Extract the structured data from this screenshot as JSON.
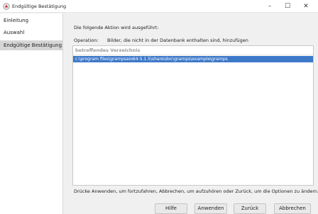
{
  "window": {
    "title": "Endgültige Bestätigung",
    "app_icon": "gramps-app-icon",
    "controls": {
      "minimize": "–",
      "maximize": "☐",
      "close": "✕"
    }
  },
  "sidebar": {
    "items": [
      {
        "label": "Einleitung",
        "active": false
      },
      {
        "label": "Auswahl",
        "active": false
      },
      {
        "label": "Endgültige Bestätigung",
        "active": true
      }
    ]
  },
  "main": {
    "description": "Die folgende Aktion wird ausgeführt:",
    "operation_label": "Operation:",
    "operation_value": "Bilder, die nicht in der Datenbank enthalten sind, hinzufügen",
    "list": {
      "header": "betreffendes Verzeichnis",
      "rows": [
        "c:\\program files\\grampsaio64-5.1.5\\share\\doc\\gramps\\example\\gramps"
      ]
    },
    "hint": "Drücke Anwenden, um fortzufahren, Abbrechen, um aufzuhören oder Zurück, um die Optionen zu ändern."
  },
  "buttons": {
    "help": "Hilfe",
    "apply": "Anwenden",
    "back": "Zurück",
    "cancel": "Abbrechen"
  },
  "colors": {
    "selection": "#3d79c9",
    "sidebar_active": "#d6d6d6",
    "background": "#f0f0f0"
  }
}
